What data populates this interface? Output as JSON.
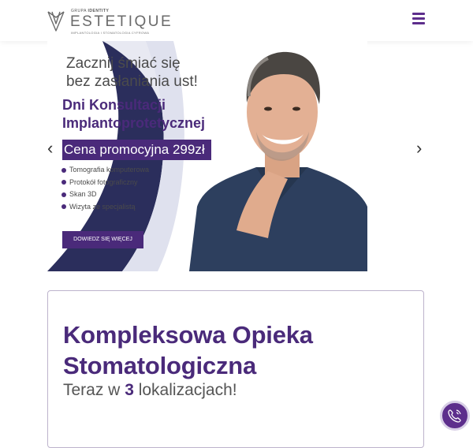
{
  "header": {
    "logo": {
      "top_label_prefix": "GRUPA",
      "top_label_brand": "IDENTITY",
      "name": "ESTETIQUE",
      "tagline": "IMPLANTOLOGIA I STOMATOLOGIA CYFROWA"
    },
    "menu_icon": "hamburger-icon"
  },
  "hero": {
    "line1": "Zacznij śmiać się",
    "line2": "bez zasłaniania ust!",
    "title_line1": "Dni Konsultacji",
    "title_line2": "Implantoprotetycznej",
    "promo": "Cena promocyjna 299zł",
    "bullets": [
      "Tomografia komputerowa",
      "Protokół fotograficzny",
      "Skan 3D",
      "Wizyta ze specjalistą"
    ],
    "cta_label": "DOWIEDZ SIĘ WIĘCEJ",
    "prev_arrow": "‹",
    "next_arrow": "›"
  },
  "card": {
    "title_line1": "Kompleksowa Opieka",
    "title_line2": "Stomatologiczna",
    "subtitle_prefix": "Teraz w ",
    "subtitle_number": "3",
    "subtitle_suffix": " lokalizacjach!"
  },
  "floating": {
    "call_icon": "phone-icon"
  },
  "colors": {
    "brand_purple": "#4a2a7a",
    "accent_purple": "#5d2e8c",
    "navy_arc": "#2b2e5c"
  }
}
